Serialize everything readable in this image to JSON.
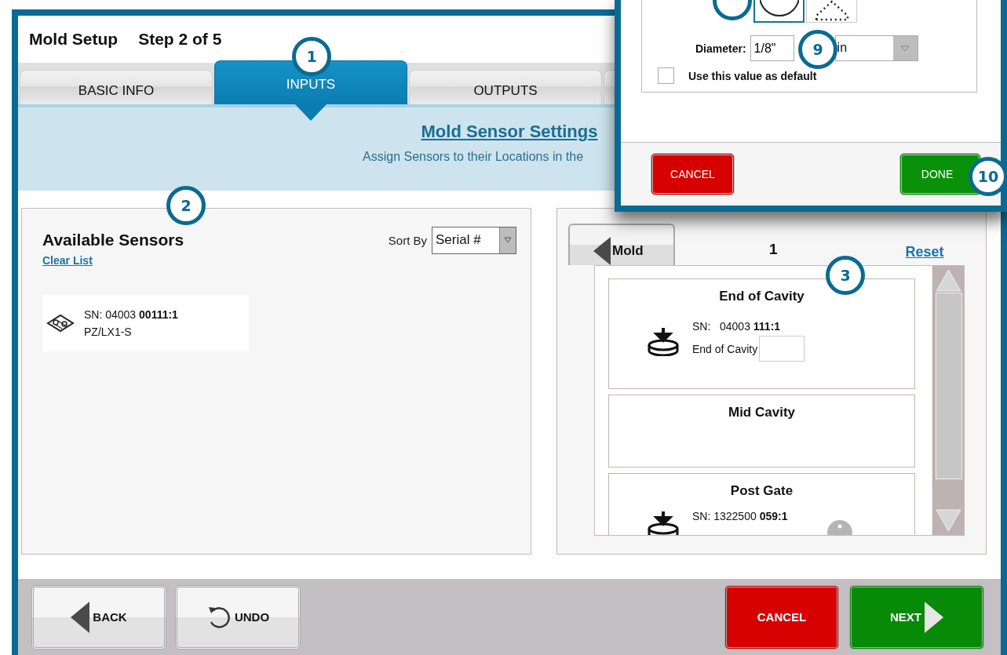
{
  "window": {
    "title": "Mold Setup",
    "step": "Step 2 of 5"
  },
  "tabs": [
    {
      "label": "BASIC INFO",
      "selected": false
    },
    {
      "label": "INPUTS",
      "selected": true
    },
    {
      "label": "OUTPUTS",
      "selected": false
    }
  ],
  "banner": {
    "title": "Mold Sensor Settings",
    "subtitle": "Assign Sensors to their Locations in the"
  },
  "available": {
    "title": "Available Sensors",
    "clear_link": "Clear List",
    "sort_label": "Sort By",
    "sort_value": "Serial #",
    "sensors": [
      {
        "sn": "SN: 04003 **00111:1**",
        "model": "PZ/LX1-S"
      }
    ]
  },
  "locations": {
    "back_button": "Mold",
    "page": "1",
    "reset_link": "Reset",
    "items": [
      {
        "name": "End of Cavity",
        "kind": "with_input",
        "sn": "SN:   04003 **111:1**",
        "label": "End of Cavity"
      },
      {
        "name": "Mid Cavity",
        "kind": "empty"
      },
      {
        "name": "Post Gate",
        "kind": "with_info",
        "sn": "SN: 1322500 **059:1**"
      }
    ]
  },
  "dialog": {
    "shapes": [
      {
        "kind": "round",
        "selected": true
      },
      {
        "kind": "arch",
        "selected": false
      }
    ],
    "diameter_label": "Diameter:",
    "diameter_value": "1/8\"",
    "unit": "in",
    "default_checkbox": {
      "label": "Use this value as default",
      "checked": false
    },
    "cancel": "CANCEL",
    "done": "DONE"
  },
  "footer": {
    "back": "BACK",
    "undo": "UNDO",
    "cancel": "CANCEL",
    "next": "NEXT"
  },
  "callouts": [
    "1",
    "2",
    "3",
    "9",
    "10"
  ]
}
